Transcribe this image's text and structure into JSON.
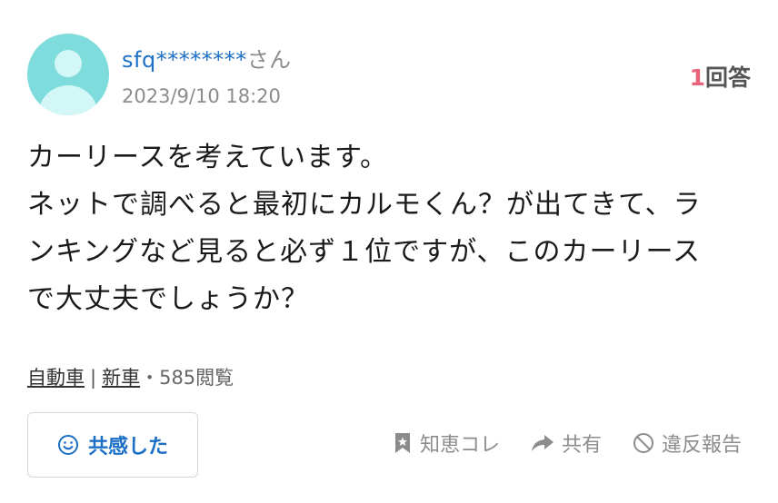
{
  "user": {
    "name": "sfq********",
    "suffix": "さん",
    "date": "2023/9/10 18:20"
  },
  "answers": {
    "count": "1",
    "label": "回答"
  },
  "question": {
    "lines": [
      "カーリースを考えています。",
      "ネットで調べると最初にカルモくん？が出てきて、ラ",
      "ンキングなど見ると必ず１位ですが、このカーリース",
      "で大丈夫でしょうか？"
    ]
  },
  "meta": {
    "category1": "自動車",
    "separator": "|",
    "category2": "新車",
    "dot": "・",
    "views": "585閲覧"
  },
  "buttons": {
    "empathy": "共感した",
    "chiebukuro": "知恵コレ",
    "share": "共有",
    "report": "違反報告"
  },
  "icons": {
    "empathy": "smile-icon",
    "chiebukuro": "bookmark-star-icon",
    "share": "share-arrow-icon",
    "report": "prohibited-icon"
  },
  "colors": {
    "link": "#1c6fc7",
    "accent_count": "#e8637a",
    "muted": "#8c8c8c",
    "avatar": "#7fdcdc"
  }
}
